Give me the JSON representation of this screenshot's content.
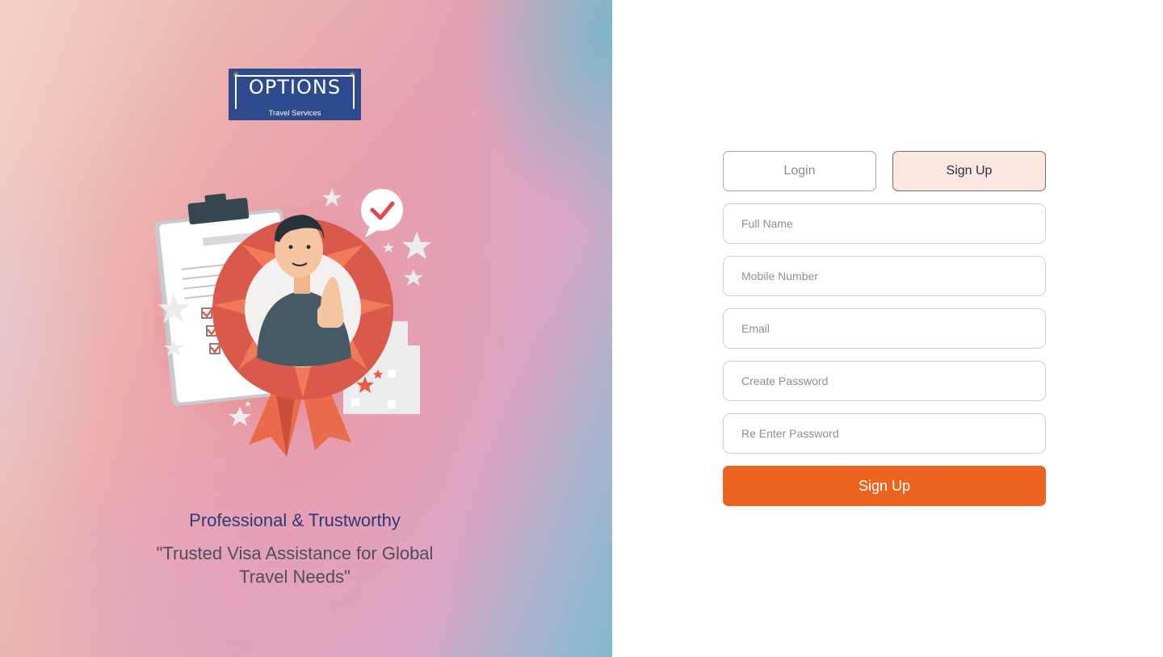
{
  "brand": {
    "logo_word": "OPTIONS",
    "logo_tagline": "Travel Services"
  },
  "hero": {
    "title": "Professional & Trustworthy",
    "quote": "\"Trusted Visa Assistance for Global Travel Needs\""
  },
  "tabs": {
    "login_label": "Login",
    "signup_label": "Sign Up",
    "active": "Sign Up"
  },
  "form": {
    "full_name_placeholder": "Full Name",
    "mobile_placeholder": "Mobile Number",
    "email_placeholder": "Email",
    "password_placeholder": "Create Password",
    "reenter_placeholder": "Re Enter Password",
    "submit_label": "Sign Up"
  },
  "colors": {
    "brand_blue": "#2e4a8f",
    "accent_orange": "#ec6420",
    "active_tab_bg": "#fbe6e0",
    "heading_navy": "#2c3a72"
  },
  "icons": {
    "illustration": "award-ribbon-thumbs-up-illustration",
    "check": "checkmark-bubble-icon"
  }
}
